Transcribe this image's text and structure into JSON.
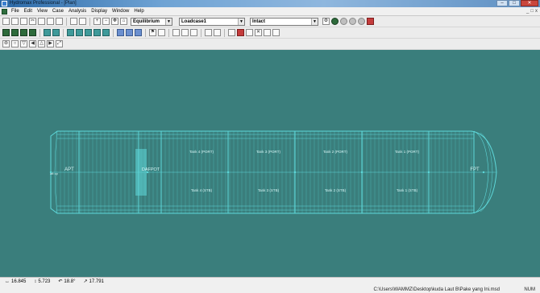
{
  "window": {
    "title": "Hydromax Professional - [Plan]",
    "controls": {
      "minimize": "–",
      "maximize": "□",
      "close": "✕"
    }
  },
  "menu": {
    "items": [
      "File",
      "Edit",
      "View",
      "Case",
      "Analysis",
      "Display",
      "Window",
      "Help"
    ],
    "mdi_controls": [
      "_",
      "□",
      "x"
    ]
  },
  "toolbar": {
    "analysis_type": "Equilibrium",
    "loadcase": "Loadcase1",
    "damage_case": "Intact"
  },
  "view": {
    "background_color": "#3a7e7c",
    "hull_color": "#5ed8da",
    "label_color": "#d8f6f6",
    "aft_label": "APT",
    "fore_label": "FPT",
    "aft_marker": "aft cp",
    "center_label": "DAFPOT",
    "tanks": [
      {
        "port": "Tank 4 (PORT)",
        "stbd": "Tank 4 (STB)"
      },
      {
        "port": "Tank 3 (PORT)",
        "stbd": "Tank 3 (STB)"
      },
      {
        "port": "Tank 2 (PORT)",
        "stbd": "Tank 2 (STB)"
      },
      {
        "port": "Tank 1 (PORT)",
        "stbd": "Tank 1 (STB)"
      }
    ]
  },
  "status": {
    "coord_x": "16.845",
    "coord_y": "5.723",
    "angle": "18.8°",
    "distance": "17.791",
    "file_path": "C:\\Users\\WAMMZ\\Desktop\\kuda Laut B\\Pake yang Ini.msd",
    "num": "NUM"
  }
}
